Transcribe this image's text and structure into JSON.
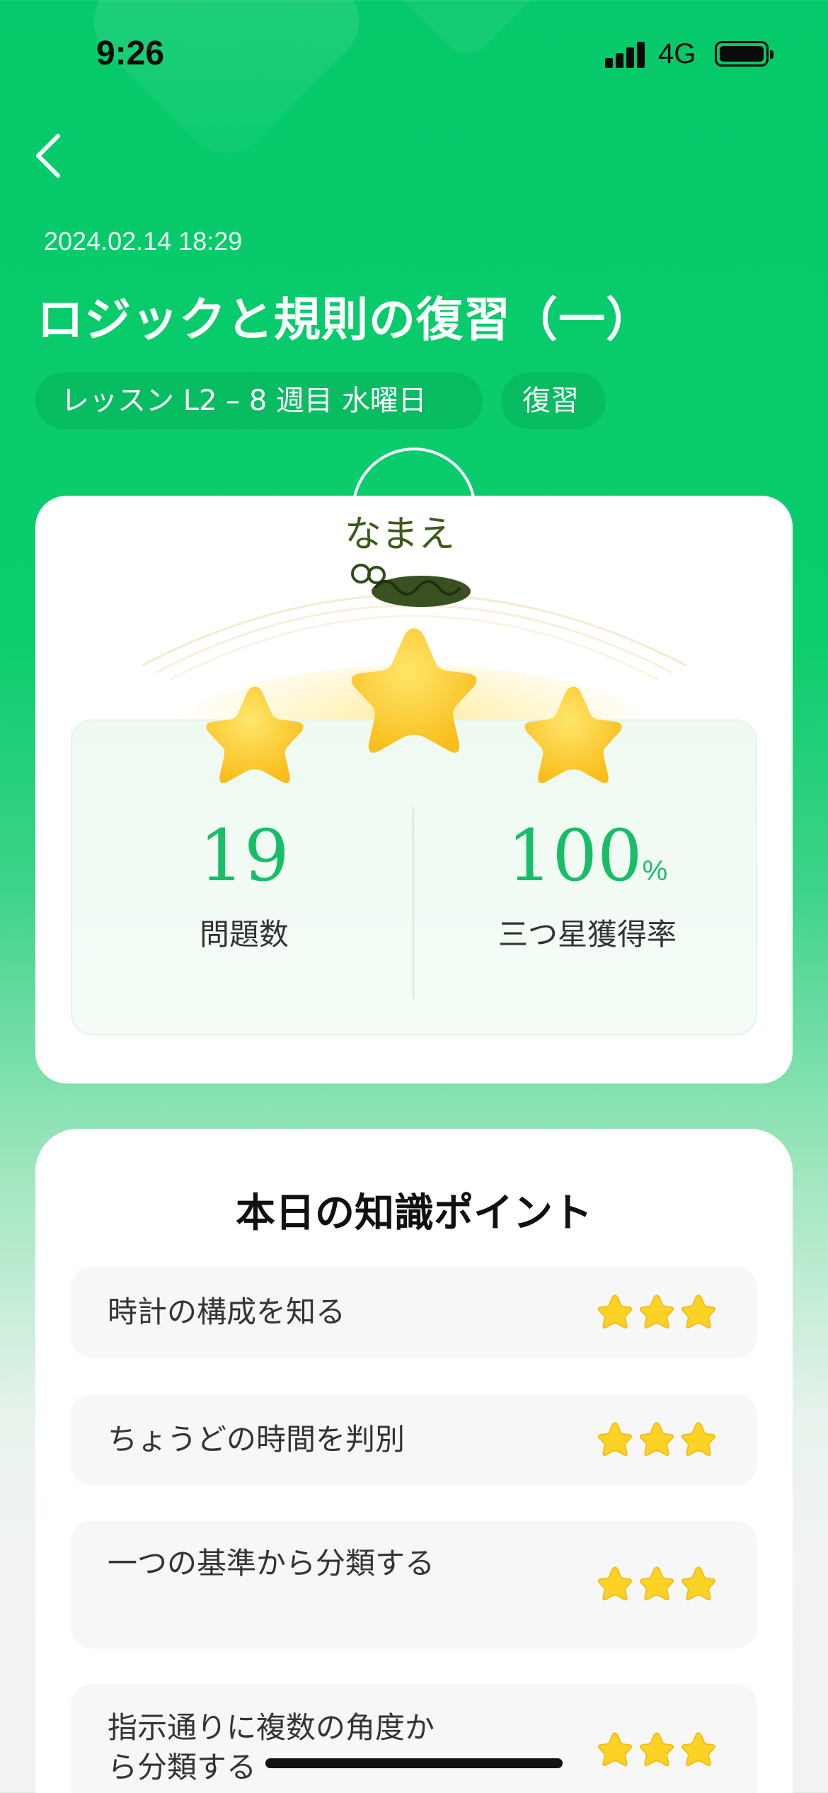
{
  "status_bar": {
    "time": "9:26",
    "network": "4G"
  },
  "header": {
    "date": "2024.02.14 18:29",
    "title": "ロジックと規則の復習（一）",
    "tags": [
      "レッスン L2 – 8 週目 水曜日",
      "復習"
    ]
  },
  "score": {
    "name_label": "なまえ",
    "stars_earned": 3,
    "stars_total": 3,
    "question_count": "19",
    "question_count_label": "問題数",
    "three_star_rate": "100",
    "three_star_rate_unit": "%",
    "three_star_rate_label": "三つ星獲得率"
  },
  "knowledge": {
    "title": "本日の知識ポイント",
    "items": [
      {
        "label": "時計の構成を知る",
        "stars": 3
      },
      {
        "label": "ちょうどの時間を判別",
        "stars": 3
      },
      {
        "label": "一つの基準から分類する",
        "stars": 3
      },
      {
        "label": "指示通りに複数の角度から分類する",
        "stars": 3
      }
    ]
  },
  "colors": {
    "accent": "#18bd68",
    "background_top": "#05c96a",
    "star": "#fcd224"
  },
  "icons": [
    "back-chevron-icon",
    "signal-icon",
    "battery-icon",
    "star-icon"
  ]
}
